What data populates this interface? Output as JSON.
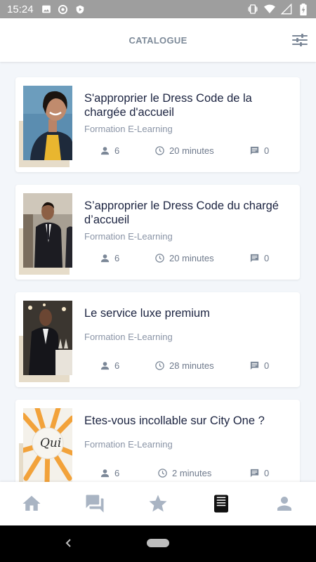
{
  "status_bar": {
    "time": "15:24"
  },
  "header": {
    "title": "CATALOGUE",
    "filter_icon": "tune-icon"
  },
  "courses": [
    {
      "title": "S'approprier le Dress Code de la chargée d'accueil",
      "type": "Formation E-Learning",
      "participants": "6",
      "duration": "20 minutes",
      "comments": "0"
    },
    {
      "title": "S’approprier le Dress Code du chargé d’accueil",
      "type": "Formation E-Learning",
      "participants": "6",
      "duration": "20 minutes",
      "comments": "0"
    },
    {
      "title": "Le service luxe premium",
      "type": "Formation E-Learning",
      "participants": "6",
      "duration": "28 minutes",
      "comments": "0"
    },
    {
      "title": "Etes-vous incollable sur City One ?",
      "type": "Formation E-Learning",
      "participants": "6",
      "duration": "2 minutes",
      "comments": "0"
    }
  ],
  "bottom_nav": [
    {
      "icon": "home-icon",
      "active": false
    },
    {
      "icon": "forum-icon",
      "active": false
    },
    {
      "icon": "star-icon",
      "active": false
    },
    {
      "icon": "book-icon",
      "active": true
    },
    {
      "icon": "person-icon",
      "active": false
    }
  ],
  "colors": {
    "title": "#1b2340",
    "muted": "#8a94a6",
    "icon": "#7b8797",
    "active_icon": "#111111",
    "nav_inactive": "#a9b4c3"
  }
}
